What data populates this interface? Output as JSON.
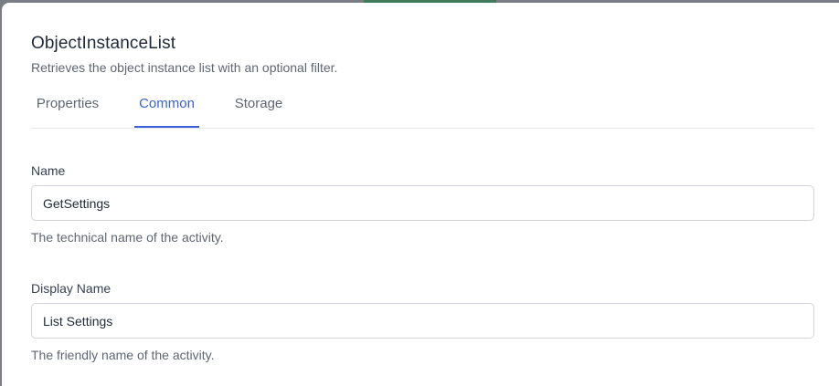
{
  "header": {
    "title": "ObjectInstanceList",
    "subtitle": "Retrieves the object instance list with an optional filter."
  },
  "tabs": [
    {
      "label": "Properties",
      "active": false
    },
    {
      "label": "Common",
      "active": true
    },
    {
      "label": "Storage",
      "active": false
    }
  ],
  "fields": {
    "name": {
      "label": "Name",
      "value": "GetSettings",
      "help": "The technical name of the activity."
    },
    "display_name": {
      "label": "Display Name",
      "value": "List Settings",
      "help": "The friendly name of the activity."
    }
  },
  "colors": {
    "accent": "#3b62d6",
    "text": "#1f2937",
    "muted": "#5f6673",
    "border": "#d1d5db"
  }
}
